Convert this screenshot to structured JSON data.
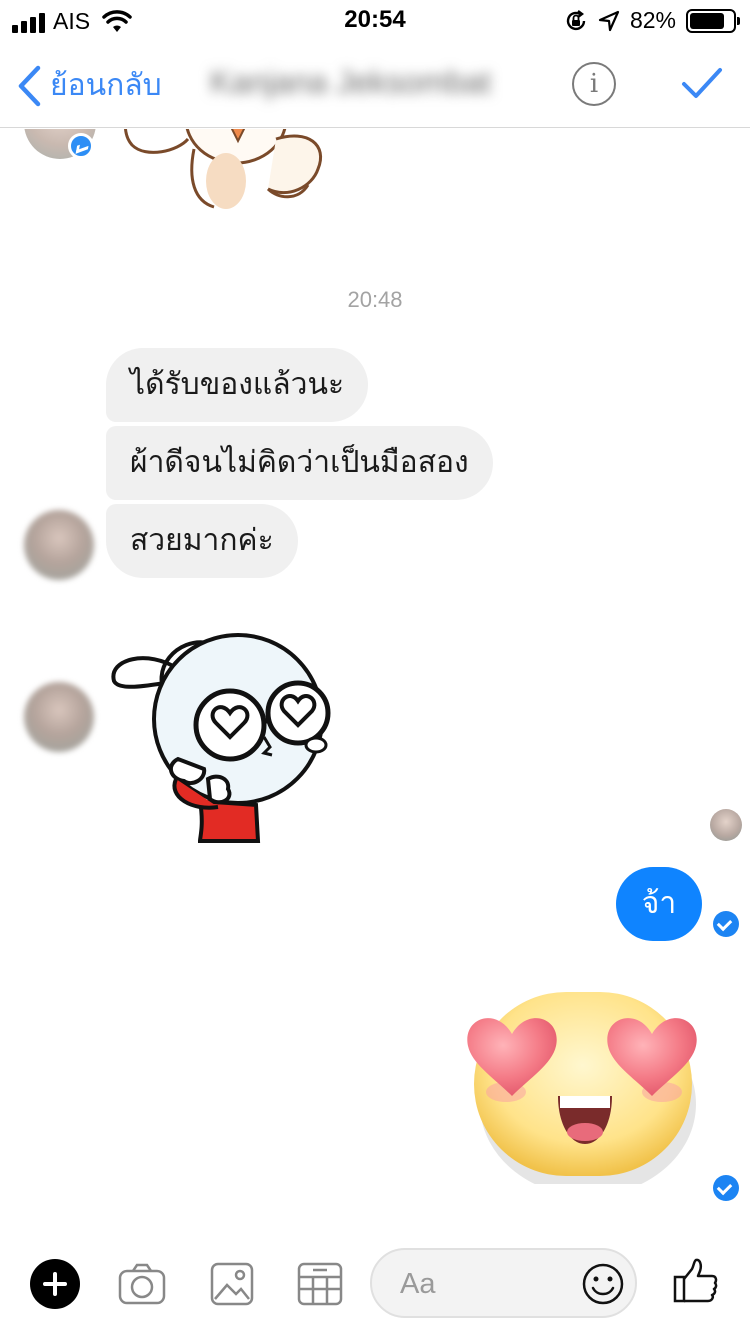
{
  "status_bar": {
    "carrier": "AIS",
    "time": "20:54",
    "battery_percent": "82%",
    "battery_level": 0.82,
    "icons": [
      "signal-icon",
      "wifi-icon",
      "orientation-lock-icon",
      "location-icon",
      "battery-icon"
    ]
  },
  "nav": {
    "back_label": "ย้อนกลับ",
    "contact_name": "Kanjana Jeksombat",
    "info_icon": "info-icon",
    "done_icon": "checkmark-icon"
  },
  "chat": {
    "timestamp": "20:48",
    "incoming": [
      {
        "text": "ได้รับของแล้วนะ"
      },
      {
        "text": "ผ้าดีจนไม่คิดว่าเป็นมือสอง"
      },
      {
        "text": "สวยมากค่ะ"
      }
    ],
    "outgoing": [
      {
        "text": "จ้า"
      }
    ],
    "stickers": [
      "cute-character-sticker",
      "bunny-heart-eyes-sticker",
      "heart-eyes-emoji-sticker"
    ]
  },
  "composer": {
    "placeholder": "Aa",
    "icons": [
      "plus-icon",
      "camera-icon",
      "gallery-icon",
      "calendar-icon",
      "smiley-icon",
      "thumbs-up-icon"
    ]
  },
  "colors": {
    "accent": "#3b88f5",
    "outgoing_bubble": "#0f84ff",
    "incoming_bubble": "#f0f0f0",
    "timestamp": "#a3a3a3"
  }
}
